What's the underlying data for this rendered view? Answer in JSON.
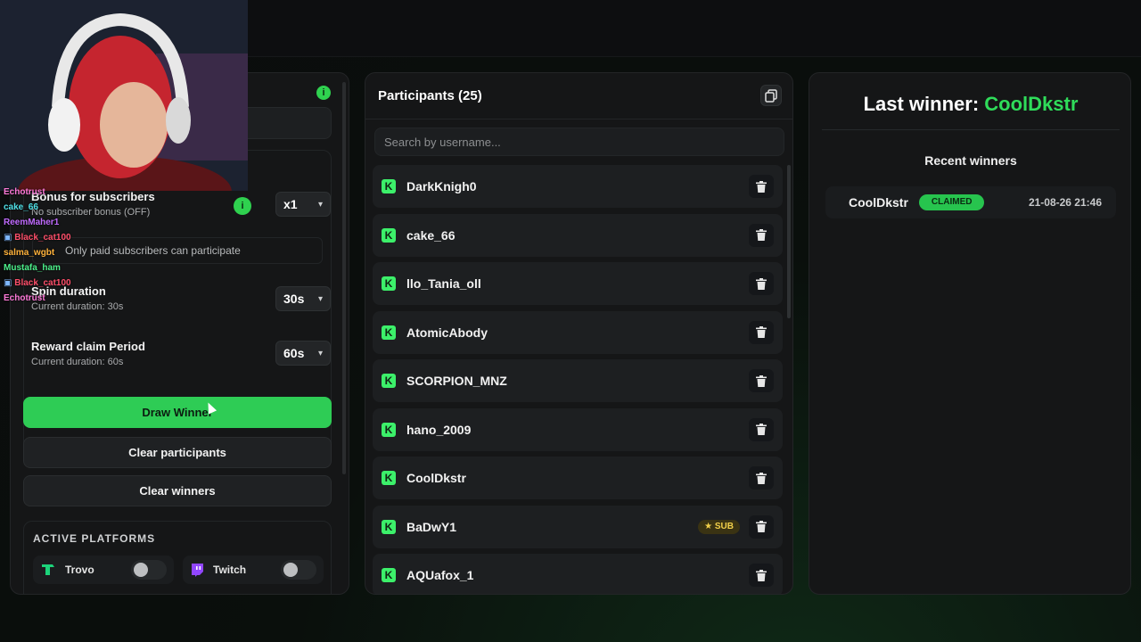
{
  "left": {
    "bonus": {
      "title": "Bonus for subscribers",
      "subtitle": "No subscriber bonus (OFF)",
      "value": "x1"
    },
    "subs_note": "Only paid subscribers can participate",
    "spin": {
      "title": "Spin duration",
      "subtitle": "Current duration: 30s",
      "value": "30s"
    },
    "reward": {
      "title": "Reward claim Period",
      "subtitle": "Current duration: 60s",
      "value": "60s"
    },
    "buttons": {
      "draw": "Draw Winner",
      "clear_participants": "Clear participants",
      "clear_winners": "Clear winners"
    },
    "platforms_title": "ACTIVE PLATFORMS",
    "platforms": [
      {
        "name": "Trovo",
        "color": "#1cd37a",
        "icon": "trovo-icon"
      },
      {
        "name": "Twitch",
        "color": "#9146ff",
        "icon": "twitch-icon"
      }
    ],
    "info_icon": "i"
  },
  "participants": {
    "title": "Participants (25)",
    "search_placeholder": "Search by username...",
    "sub_badge": "SUB",
    "platform_icon": "K",
    "items": [
      {
        "name": "DarkKnigh0"
      },
      {
        "name": "cake_66"
      },
      {
        "name": "llo_Tania_oll"
      },
      {
        "name": "AtomicAbody"
      },
      {
        "name": "SCORPION_MNZ"
      },
      {
        "name": "hano_2009"
      },
      {
        "name": "CoolDkstr"
      },
      {
        "name": "BaDwY1",
        "sub": true
      },
      {
        "name": "AQUafox_1"
      }
    ]
  },
  "winner": {
    "label": "Last winner:",
    "name": "CoolDkstr",
    "recent_title": "Recent winners",
    "recent": [
      {
        "name": "CoolDkstr",
        "status": "CLAIMED",
        "date": "21-08-26 21:46"
      }
    ]
  },
  "chat": [
    {
      "user": "Echotrust",
      "color": "#ff7ad9",
      "text": ""
    },
    {
      "user": "cake_66",
      "color": "#4fe0e6",
      "text": ""
    },
    {
      "user": "ReemMaher1",
      "color": "#c06bff",
      "text": ""
    },
    {
      "user": "Black_cat100",
      "color": "#ff4f6a",
      "text": ""
    },
    {
      "user": "salma_wgbt",
      "color": "#ffb23b",
      "text": ""
    },
    {
      "user": "Mustafa_ham",
      "color": "#4cf08a",
      "text": ""
    },
    {
      "user": "Black_cat100",
      "color": "#ff4f6a",
      "text": ""
    },
    {
      "user": "Echotrust",
      "color": "#ff7ad9",
      "text": ""
    }
  ],
  "colors": {
    "accent": "#2fdc5a",
    "kick": "#3cf06a",
    "sub_badge": "#f2d04a"
  }
}
